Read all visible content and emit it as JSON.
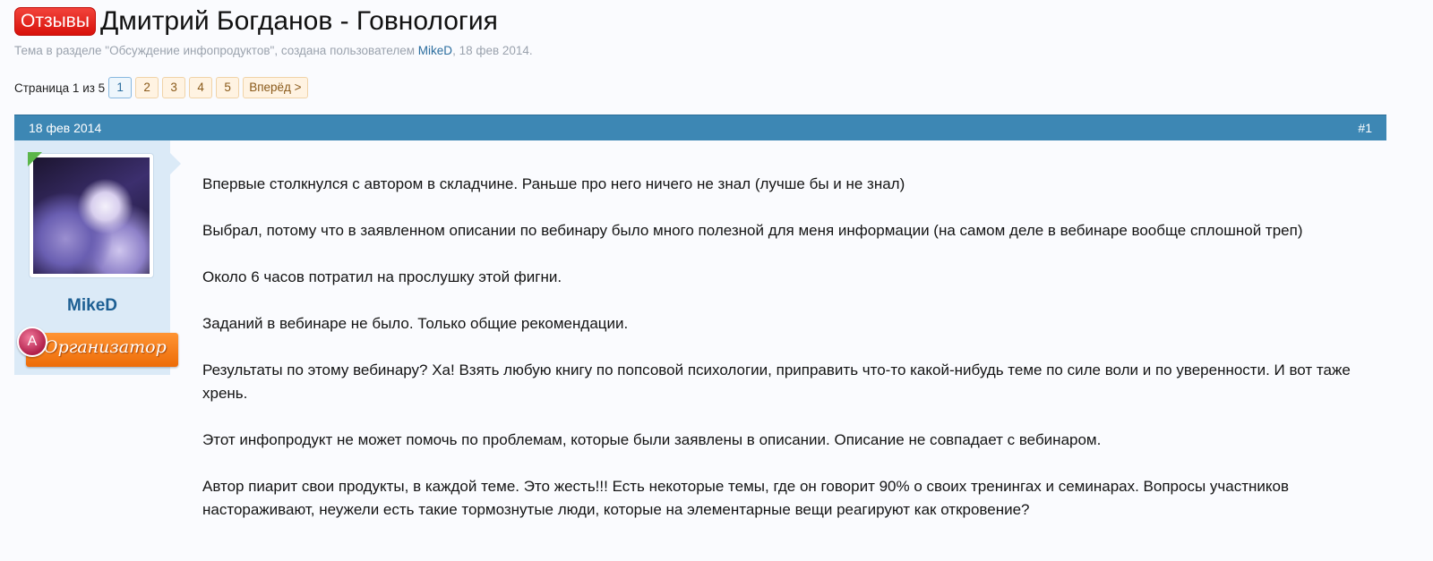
{
  "thread": {
    "prefix": "Отзывы",
    "title": "Дмитрий Богданов - Говнология",
    "meta_pre": "Тема в разделе \"Обсуждение инфопродуктов\", создана пользователем ",
    "meta_author": "MikeD",
    "meta_post": ", 18 фев 2014."
  },
  "pagenav": {
    "label": "Страница 1 из 5",
    "pages": [
      "1",
      "2",
      "3",
      "4",
      "5"
    ],
    "current": "1",
    "next": "Вперёд >"
  },
  "post": {
    "date": "18 фев 2014",
    "number": "#1",
    "author": "MikeD",
    "user_title": "Организатор",
    "badge_letter": "A",
    "paragraphs": [
      "Впервые столкнулся с автором в складчине. Раньше про него ничего не знал (лучше бы и не знал)",
      "Выбрал, потому что в заявленном описании по вебинару было много полезной для меня информации (на самом деле в вебинаре вообще сплошной треп)",
      "Около 6 часов потратил на прослушку этой фигни.",
      "Заданий в вебинаре не было. Только общие рекомендации.",
      "Результаты по этому вебинару? Ха! Взять любую книгу по попсовой психологии, приправить что-то какой-нибудь теме по силе воли и по уверенности. И вот таже хрень.",
      "Этот инфопродукт не может помочь по проблемам, которые были заявлены в описании. Описание не совпадает с вебинаром.",
      "Автор пиарит свои продукты, в каждой теме. Это жесть!!! Есть некоторые темы, где он говорит 90% о своих тренингах и семинарах. Вопросы участников настораживают, неужели есть такие тормознутые люди, которые на элементарные вещи реагируют как откровение?"
    ]
  },
  "colors": {
    "header_bar": "#3d87b4",
    "user_panel": "#dbeaf7",
    "prefix_red": "#e2231a",
    "title_orange": "#f07a12",
    "link_blue": "#2b6d9e"
  }
}
